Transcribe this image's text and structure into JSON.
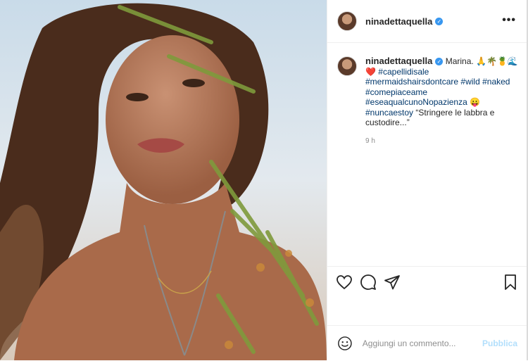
{
  "post": {
    "username": "ninadettaquella",
    "verified": true
  },
  "caption": {
    "username": "ninadettaquella",
    "text_intro": "Marina.",
    "emoji_intro": "🙏🌴🍍🌊",
    "heart": "❤️",
    "hashtags": [
      "#capellidisale",
      "#mermaidshairsdontcare",
      "#wild",
      "#naked",
      "#comepiaceame",
      "#eseaqualcunoNopazienza",
      "#nuncaestoy"
    ],
    "emoji_tongue": "😛",
    "quote": "“Stringere le labbra e custodire...”"
  },
  "timestamp": "9 h",
  "comment_box": {
    "placeholder": "Aggiungi un commento...",
    "publish_label": "Pubblica"
  },
  "icons": {
    "more": "more-options-icon",
    "like": "heart-icon",
    "comment": "comment-icon",
    "share": "share-icon",
    "save": "bookmark-icon",
    "emoji": "emoji-icon"
  },
  "colors": {
    "hashtag": "#00376b",
    "verified": "#3897f0",
    "publish_disabled": "#b2dffc",
    "muted": "#8e8e8e"
  }
}
